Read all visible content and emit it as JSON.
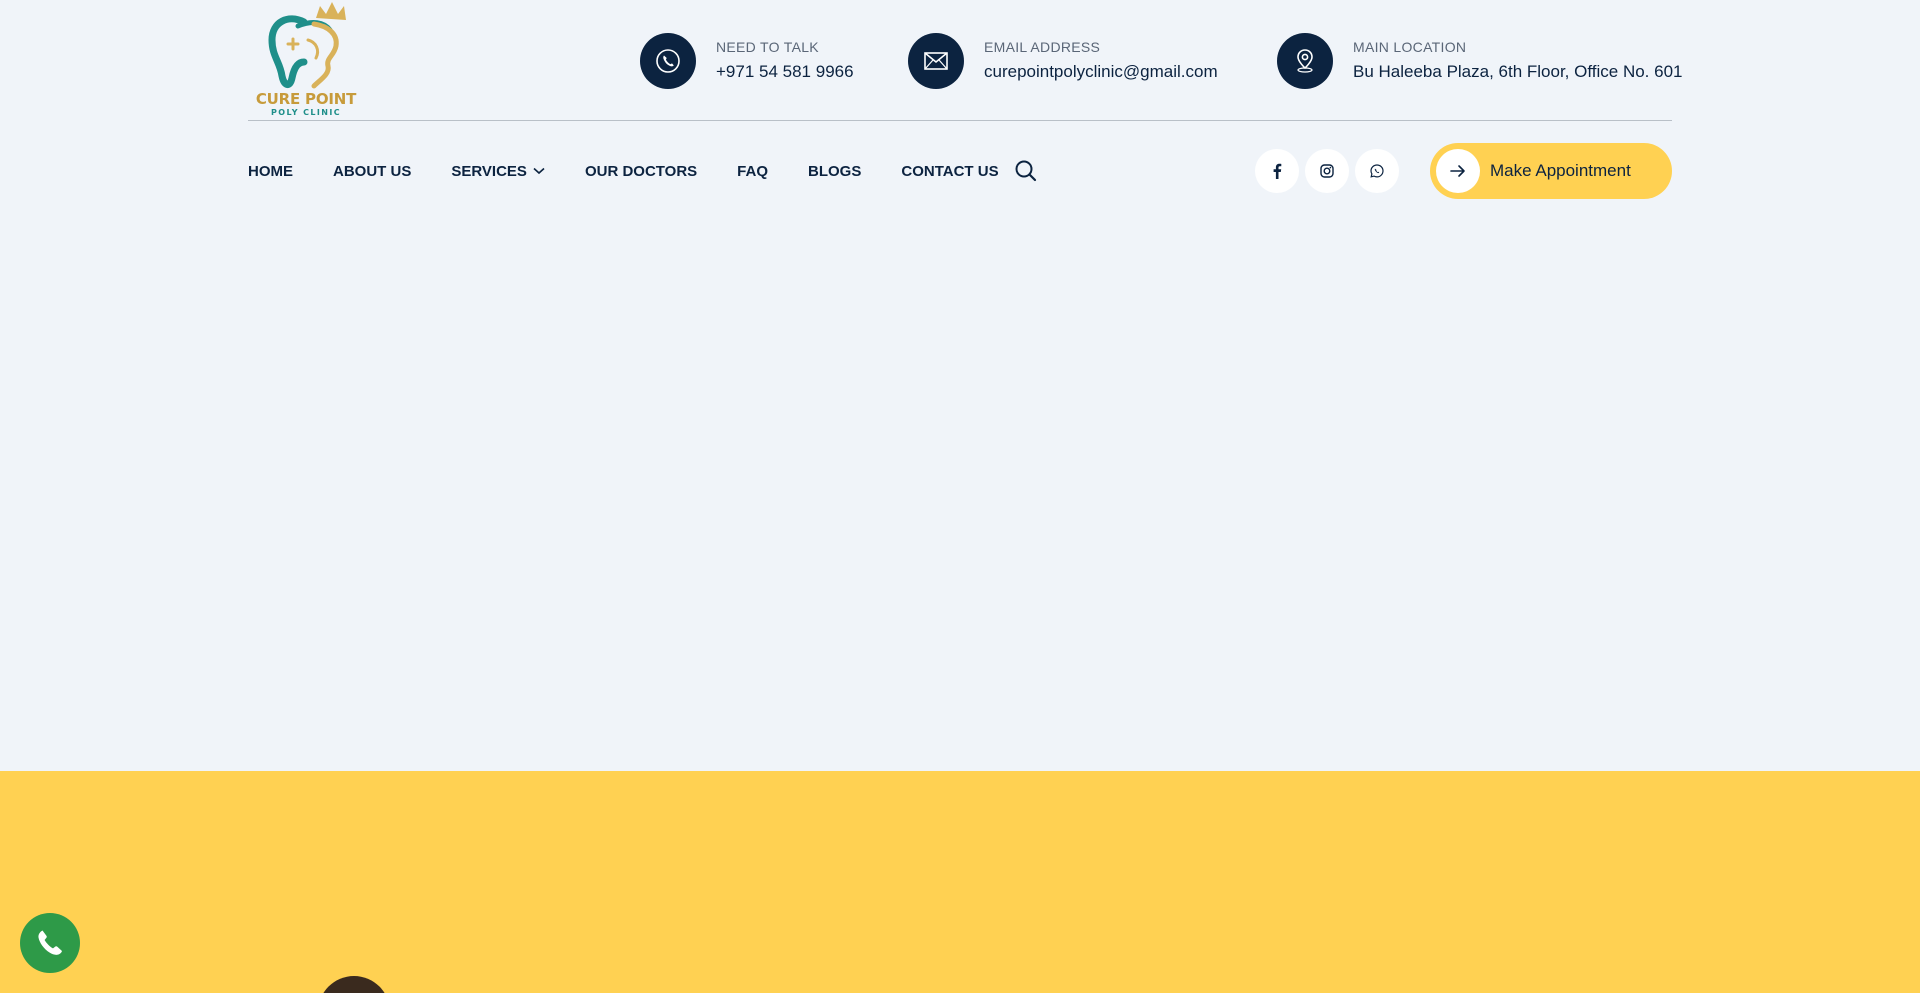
{
  "brand": {
    "name": "CURE POINT",
    "tagline": "POLY CLINIC",
    "colors": {
      "navy": "#0c2340",
      "yellow": "#ffd152",
      "teal": "#1f8f8a",
      "gold": "#c79b3b",
      "call_green": "#2e9a48"
    }
  },
  "contact": {
    "phone": {
      "icon": "phone-icon",
      "label": "NEED TO TALK",
      "value": "+971 54 581 9966"
    },
    "email": {
      "icon": "mail-icon",
      "label": "EMAIL ADDRESS",
      "value": "curepointpolyclinic@gmail.com"
    },
    "location": {
      "icon": "map-pin-icon",
      "label": "MAIN LOCATION",
      "value": "Bu Haleeba Plaza, 6th Floor, Office No. 601"
    }
  },
  "nav": {
    "items": [
      {
        "label": "HOME"
      },
      {
        "label": "ABOUT US"
      },
      {
        "label": "SERVICES",
        "has_dropdown": true
      },
      {
        "label": "OUR DOCTORS"
      },
      {
        "label": "FAQ"
      },
      {
        "label": "BLOGS"
      },
      {
        "label": "CONTACT US"
      }
    ],
    "search_icon": "search-icon"
  },
  "social": [
    "facebook-icon",
    "instagram-icon",
    "whatsapp-icon"
  ],
  "cta": {
    "label": "Make Appointment",
    "icon": "arrow-right-icon"
  },
  "floating": {
    "icon": "phone-icon"
  }
}
